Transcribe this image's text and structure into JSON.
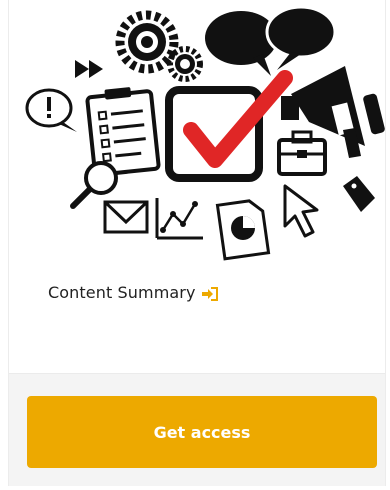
{
  "card": {
    "title": "Content Summary",
    "title_icon": "sign-in-icon",
    "cta_label": "Get access"
  },
  "hero": {
    "icons": [
      "speech-bubbles-icon",
      "gears-icon",
      "fast-forward-icon",
      "exclamation-bubble-icon",
      "clipboard-checklist-icon",
      "magnifier-icon",
      "checkbox-check-icon",
      "megaphone-icon",
      "briefcase-icon",
      "price-tag-icon",
      "envelope-icon",
      "line-chart-icon",
      "pie-chart-document-icon",
      "cursor-arrow-icon"
    ]
  },
  "colors": {
    "accent": "#eda900",
    "check": "#e02626",
    "icon": "#111111",
    "footer_bg": "#f4f4f4"
  }
}
